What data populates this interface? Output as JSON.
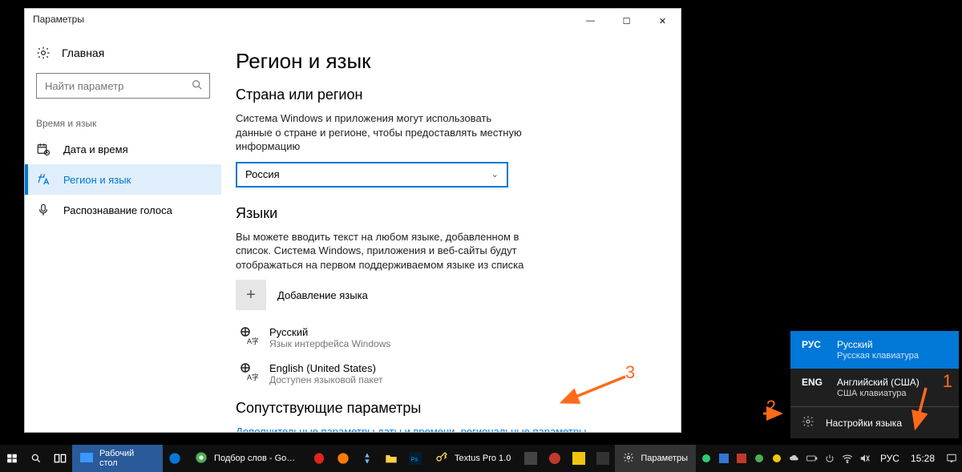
{
  "window": {
    "title": "Параметры",
    "controls": {
      "min": "—",
      "max": "☐",
      "close": "✕"
    }
  },
  "sidebar": {
    "home": "Главная",
    "search_placeholder": "Найти параметр",
    "group": "Время и язык",
    "items": [
      {
        "label": "Дата и время"
      },
      {
        "label": "Регион и язык"
      },
      {
        "label": "Распознавание голоса"
      }
    ]
  },
  "content": {
    "page_title": "Регион и язык",
    "region_header": "Страна или регион",
    "region_desc": "Система Windows и приложения могут использовать данные о стране и регионе, чтобы предоставлять местную информацию",
    "region_value": "Россия",
    "lang_header": "Языки",
    "lang_desc": "Вы можете вводить текст на любом языке, добавленном в список. Система Windows, приложения и веб-сайты будут отображаться на первом поддерживаемом языке из списка",
    "add_lang": "Добавление языка",
    "langs": [
      {
        "name": "Русский",
        "sub": "Язык интерфейса Windows"
      },
      {
        "name": "English (United States)",
        "sub": "Доступен языковой пакет"
      }
    ],
    "related_header": "Сопутствующие параметры",
    "related_link": "Дополнительные параметры даты и времени, региональные параметры"
  },
  "lang_flyout": {
    "items": [
      {
        "code": "РУС",
        "name": "Русский",
        "sub": "Русская клавиатура",
        "selected": true
      },
      {
        "code": "ENG",
        "name": "Английский (США)",
        "sub": "США клавиатура",
        "selected": false
      }
    ],
    "settings": "Настройки языка"
  },
  "taskbar": {
    "desktop_task": "Рабочий стол",
    "tasks": [
      "Подбор слов - Googl...",
      "Textus Pro 1.0",
      "Параметры"
    ],
    "lang": "РУС",
    "time": "15:28"
  },
  "annotations": {
    "n1": "1",
    "n2": "2",
    "n3": "3"
  }
}
